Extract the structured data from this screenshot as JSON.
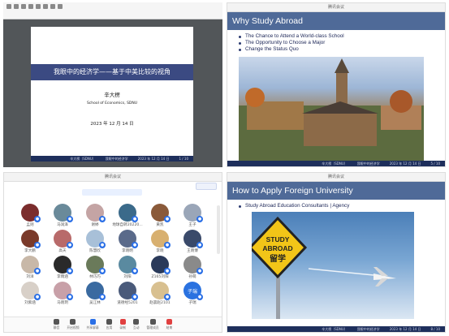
{
  "panels": {
    "top_left": {
      "window_title": "腾讯会议",
      "slide_title": "我眼中的经济学——基于中美比较的视角",
      "author": "辛大楞",
      "school": "School of Economics, SDNU",
      "date": "2023 年 12 月 14 日",
      "footer_left": "辛大楞（SDNU）",
      "footer_center": "我眼中的经济学",
      "footer_right": "2023 年 12 月 14 日",
      "page": "1 / 10"
    },
    "top_right": {
      "window_title": "腾讯会议",
      "slide_title": "Why Study Abroad",
      "bullets": [
        "The Chance to Attend a World-class School",
        "The Opportunity to Choose a Major",
        "Change the Status Quo"
      ],
      "footer_left": "辛大楞（SDNU）",
      "footer_center": "我眼中的经济学",
      "footer_right": "2023 年 12 月 14 日",
      "page": "5 / 10"
    },
    "bottom_left": {
      "window_title": "腾讯会议",
      "search_placeholder": "",
      "mic_label": "",
      "participants": [
        {
          "name": "孟则",
          "color": "#7b2d2d"
        },
        {
          "name": "马润泽",
          "color": "#6a8a9a"
        },
        {
          "name": "谢婷",
          "color": "#c4a4a4"
        },
        {
          "name": "地球自转20220...",
          "color": "#3b6a8a"
        },
        {
          "name": "黄凯",
          "color": "#8a5a3a"
        },
        {
          "name": "王子",
          "color": "#9aa6b8"
        },
        {
          "name": "李大鹏",
          "color": "#7a3a2a"
        },
        {
          "name": "高天",
          "color": "#b86a6a"
        },
        {
          "name": "陈慧欣",
          "color": "#a8c0d8"
        },
        {
          "name": "李晓明",
          "color": "#5a6a8a"
        },
        {
          "name": "李晓",
          "color": "#d8b070"
        },
        {
          "name": "王晓博",
          "color": "#3a4a6a"
        },
        {
          "name": "刘洋",
          "color": "#c8b8a8"
        },
        {
          "name": "李雨涵",
          "color": "#2a2a2a"
        },
        {
          "name": "林巧巧",
          "color": "#6a7a5a"
        },
        {
          "name": "刘阳",
          "color": "#5a8aa0"
        },
        {
          "name": "Z165刘阳",
          "color": "#2a3a5a"
        },
        {
          "name": "孙萌",
          "color": "#8a8a8a"
        },
        {
          "name": "刘紫涵",
          "color": "#d8d0c8"
        },
        {
          "name": "马晓玥",
          "color": "#c8a0a8"
        },
        {
          "name": "吴江林",
          "color": "#3a6aa0"
        },
        {
          "name": "道德经5201",
          "color": "#4a5a7a"
        },
        {
          "name": "赵晨赵2101",
          "color": "#d8c090"
        },
        {
          "name": "子瑞",
          "color": "#2a72e0",
          "initial": "子瑞"
        }
      ],
      "dock": [
        {
          "label": "静音",
          "color": "#555"
        },
        {
          "label": "开启视频",
          "color": "#555"
        },
        {
          "label": "共享屏幕",
          "color": "#2a6fe6"
        },
        {
          "label": "应用",
          "color": "#555"
        },
        {
          "label": "录制",
          "color": "#e04040"
        },
        {
          "label": "互动",
          "color": "#555"
        },
        {
          "label": "管理成员",
          "color": "#555"
        },
        {
          "label": "结束",
          "color": "#e04040"
        }
      ]
    },
    "bottom_right": {
      "window_title": "腾讯会议",
      "slide_title": "How to Apply Foreign University",
      "bullets": [
        "Study Abroad Education Consultants | Agency"
      ],
      "sign_line1": "STUDY",
      "sign_line2": "ABROAD",
      "sign_line3": "留学",
      "footer_left": "辛大楞（SDNU）",
      "footer_center": "我眼中的经济学",
      "footer_right": "2023 年 12 月 14 日",
      "page": "8 / 10"
    }
  }
}
